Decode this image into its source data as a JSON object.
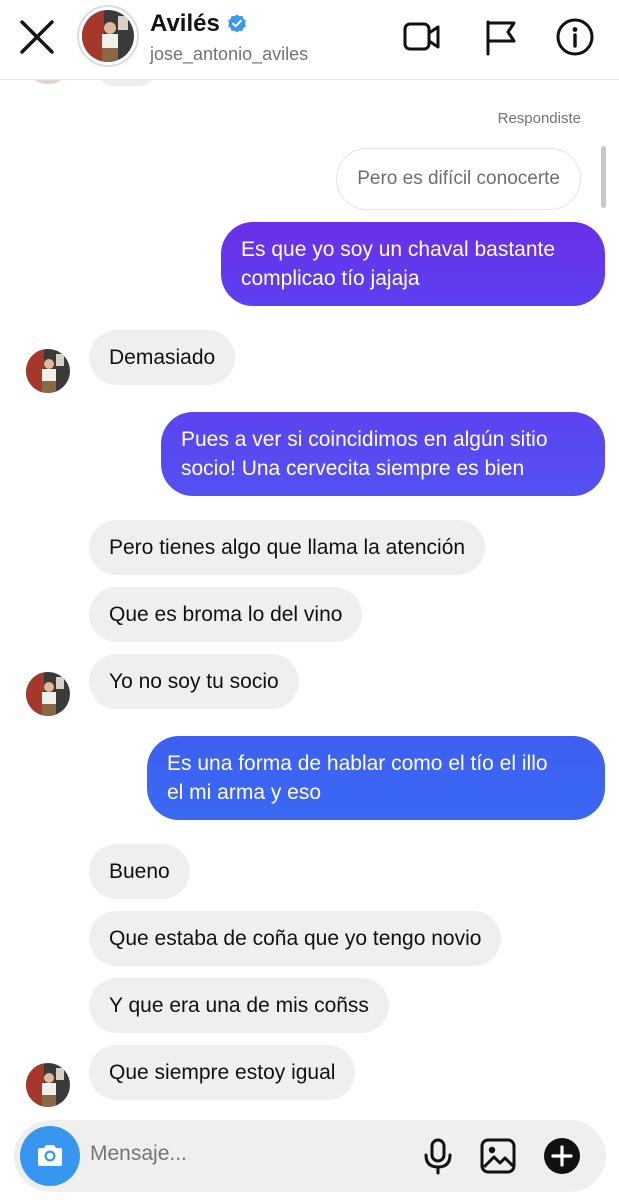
{
  "header": {
    "name": "Avilés",
    "username": "jose_antonio_aviles",
    "verified": true,
    "icons": [
      "close-icon",
      "video-call-icon",
      "flag-icon",
      "info-icon"
    ]
  },
  "chat": {
    "status_label": "Respondiste",
    "reply_preview": "Pero es difícil conocerte",
    "messages": [
      {
        "side": "out",
        "text_lines": [
          "Es que yo soy un chaval bastante",
          "complicao tío jajaja"
        ]
      },
      {
        "side": "in",
        "text_lines": [
          "Demasiado"
        ]
      },
      {
        "side": "out",
        "text_lines": [
          "Pues a ver si coincidimos en algún sitio",
          "socio! Una cervecita siempre es bien"
        ]
      },
      {
        "side": "in",
        "text_lines": [
          "Pero tienes algo que llama la atención"
        ]
      },
      {
        "side": "in",
        "text_lines": [
          "Que es broma lo del vino"
        ]
      },
      {
        "side": "in",
        "text_lines": [
          "Yo no soy tu socio"
        ]
      },
      {
        "side": "out",
        "text_lines": [
          "Es una forma de hablar como el tío el illo",
          "el mi arma y eso"
        ]
      },
      {
        "side": "in",
        "text_lines": [
          "Bueno"
        ]
      },
      {
        "side": "in",
        "text_lines": [
          "Que estaba de coña que yo tengo novio"
        ]
      },
      {
        "side": "in",
        "text_lines": [
          "Y que era una de mis coñss"
        ]
      },
      {
        "side": "in",
        "text_lines": [
          "Que siempre estoy igual"
        ]
      }
    ]
  },
  "composer": {
    "placeholder": "Mensaje...",
    "icons": [
      "camera-icon",
      "microphone-icon",
      "gallery-icon",
      "add-icon"
    ]
  },
  "colors": {
    "outgoing_gradient_top": "#6d2ee6",
    "outgoing_mid": "#5a47f0",
    "outgoing_bottom": "#3f63f2",
    "incoming_bubble": "#efefef",
    "camera_button": "#3797f0",
    "verified_badge": "#3897f0"
  }
}
